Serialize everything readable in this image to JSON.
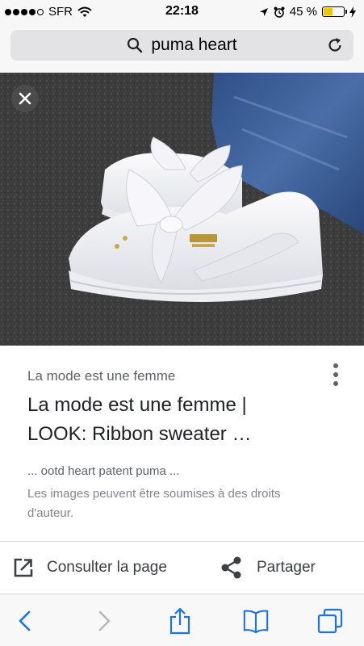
{
  "status_bar": {
    "carrier": "SFR",
    "time": "22:18",
    "battery_percent": "45 %",
    "battery_level": 0.45,
    "battery_color": "#f5c400"
  },
  "search": {
    "query": "puma heart",
    "icons": [
      "search-icon",
      "reload-icon"
    ]
  },
  "viewer": {
    "close_icon": "close-icon",
    "image_subject": "puma-basket-heart-white-sneakers-photo"
  },
  "result": {
    "site_name": "La mode est une femme",
    "title_line1": "La mode est une femme |",
    "title_line2": "LOOK: Ribbon sweater …",
    "snippet": "... ootd heart patent puma ...",
    "copyright_line1": "Les images peuvent être soumises à des droits",
    "copyright_line2": "d'auteur."
  },
  "actions": {
    "visit_label": "Consulter la page",
    "share_label": "Partager"
  },
  "toolbar": {
    "icons": [
      "back-icon",
      "forward-icon",
      "share-icon",
      "bookmarks-icon",
      "tabs-icon"
    ],
    "accent": "#1a73e8"
  }
}
